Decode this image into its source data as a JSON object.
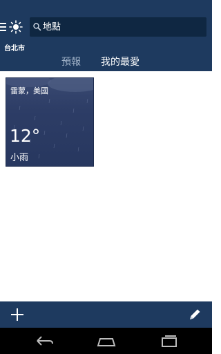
{
  "header": {
    "search_placeholder": "地點",
    "city": "台北市",
    "tabs": [
      {
        "label": "預報",
        "active": false
      },
      {
        "label": "我的最愛",
        "active": true
      }
    ]
  },
  "favorites": [
    {
      "location": "雷蒙，美國",
      "temperature": "12°",
      "condition": "小雨"
    }
  ],
  "icons": {
    "menu": "menu-icon",
    "app": "sun-icon",
    "search": "search-icon",
    "add": "plus-icon",
    "edit": "pencil-icon",
    "back": "back-icon",
    "home": "home-icon",
    "recents": "recents-icon"
  },
  "colors": {
    "header_bg": "#1e3a5f",
    "card_bg": "#2b3b64",
    "active_tab": "#ffffff",
    "inactive_tab": "#9fb1c7"
  }
}
